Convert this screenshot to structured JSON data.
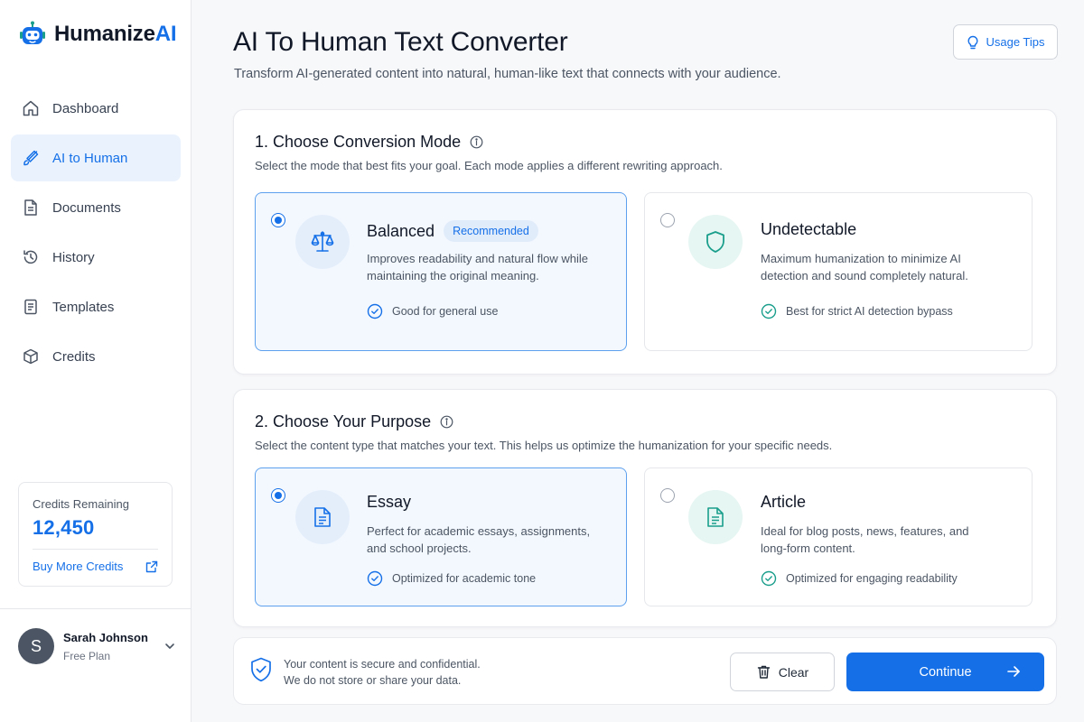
{
  "app": {
    "logo_prefix": "Humanize",
    "logo_suffix": "AI"
  },
  "sidebar": {
    "items": [
      {
        "label": "Dashboard",
        "icon": "home-icon",
        "active": false
      },
      {
        "label": "AI to Human",
        "icon": "brush-icon",
        "active": true
      },
      {
        "label": "Documents",
        "icon": "document-icon",
        "active": false
      },
      {
        "label": "History",
        "icon": "history-icon",
        "active": false
      },
      {
        "label": "Templates",
        "icon": "template-icon",
        "active": false
      },
      {
        "label": "Credits",
        "icon": "box-icon",
        "active": false
      }
    ],
    "credits": {
      "label": "Credits Remaining",
      "value": "12,450",
      "link": "Buy More Credits"
    },
    "user": {
      "initial": "S",
      "name": "Sarah Johnson",
      "plan": "Free Plan"
    }
  },
  "header": {
    "title": "AI To Human Text Converter",
    "subtitle": "Transform AI-generated content into natural, human-like text that connects with your audience.",
    "tips_label": "Usage Tips"
  },
  "mode": {
    "title": "1. Choose Conversion Mode",
    "description": "Select the mode that best fits your goal. Each mode applies a different rewriting approach.",
    "options": [
      {
        "title": "Balanced",
        "badge": "Recommended",
        "description": "Improves readability and natural flow while maintaining the original meaning.",
        "note": "Good for general use",
        "selected": true,
        "icon": "scale-icon"
      },
      {
        "title": "Undetectable",
        "badge": "",
        "description": "Maximum humanization to minimize AI detection and sound completely natural.",
        "note": "Best for strict AI detection bypass",
        "selected": false,
        "icon": "shield-icon"
      }
    ]
  },
  "purpose": {
    "title": "2. Choose Your Purpose",
    "description": "Select the content type that matches your text. This helps us optimize the humanization for your specific needs.",
    "options": [
      {
        "title": "Essay",
        "description": "Perfect for academic essays, assignments, and school projects.",
        "note": "Optimized for academic tone",
        "selected": true,
        "icon": "document-icon"
      },
      {
        "title": "Article",
        "description": "Ideal for blog posts, news, features, and long-form content.",
        "note": "Optimized for engaging readability",
        "selected": false,
        "icon": "document-icon"
      }
    ]
  },
  "footer": {
    "secure_line1": "Your content is secure and confidential.",
    "secure_line2": "We do not store or share your data.",
    "clear_label": "Clear",
    "continue_label": "Continue"
  },
  "colors": {
    "accent": "#1570e8",
    "teal": "#1a9e8c",
    "active_bg": "#eaf3fd"
  }
}
